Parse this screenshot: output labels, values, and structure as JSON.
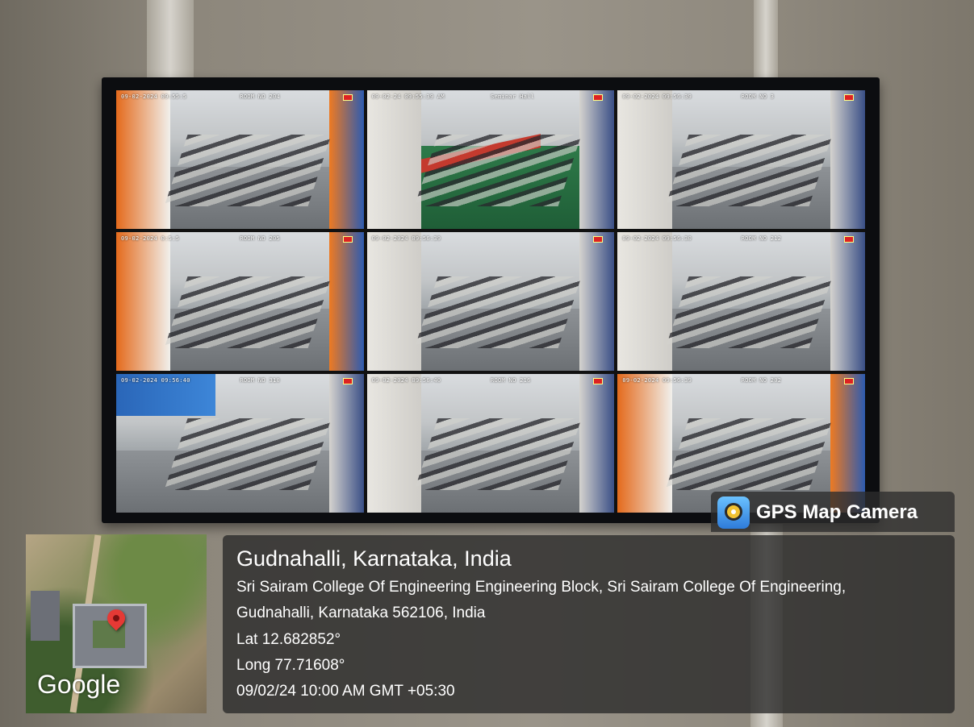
{
  "cctv": {
    "feeds": [
      {
        "timestamp": "09-02-2024 09:55:5",
        "room": "ROOM NO 204",
        "theme": "orange"
      },
      {
        "timestamp": "09-02-24 09:55:39 AM",
        "room": "Seminar Hall",
        "theme": "green"
      },
      {
        "timestamp": "09-02-2024 09:56:39",
        "room": "ROOM NO 3",
        "theme": "plain"
      },
      {
        "timestamp": "09-02-2024 0:5:5",
        "room": "ROOM NO 205",
        "theme": "orange"
      },
      {
        "timestamp": "09-02-2024 09:56:39",
        "room": "",
        "theme": "plain"
      },
      {
        "timestamp": "09-02-2024 09:56:30",
        "room": "ROOM NO 212",
        "theme": "plain"
      },
      {
        "timestamp": "09-02-2024 09:56:40",
        "room": "ROOM NO 310",
        "theme": "blue"
      },
      {
        "timestamp": "09-02-2024 09:56:40",
        "room": "ROOM NO 216",
        "theme": "plain"
      },
      {
        "timestamp": "09-02-2024 09:56:39",
        "room": "ROOM NO 202",
        "theme": "orange"
      }
    ]
  },
  "badge": {
    "app_name": "GPS Map Camera",
    "icon": "gps-map-camera-icon"
  },
  "map": {
    "provider_label": "Google",
    "pin_icon": "location-pin-icon"
  },
  "location": {
    "title": "Gudnahalli, Karnataka, India",
    "address_line1": "Sri Sairam College Of Engineering Engineering Block, Sri Sairam College Of Engineering,",
    "address_line2": "Gudnahalli, Karnataka 562106, India",
    "latitude": "Lat 12.682852°",
    "longitude": "Long 77.71608°",
    "datetime": "09/02/24 10:00 AM GMT +05:30"
  }
}
